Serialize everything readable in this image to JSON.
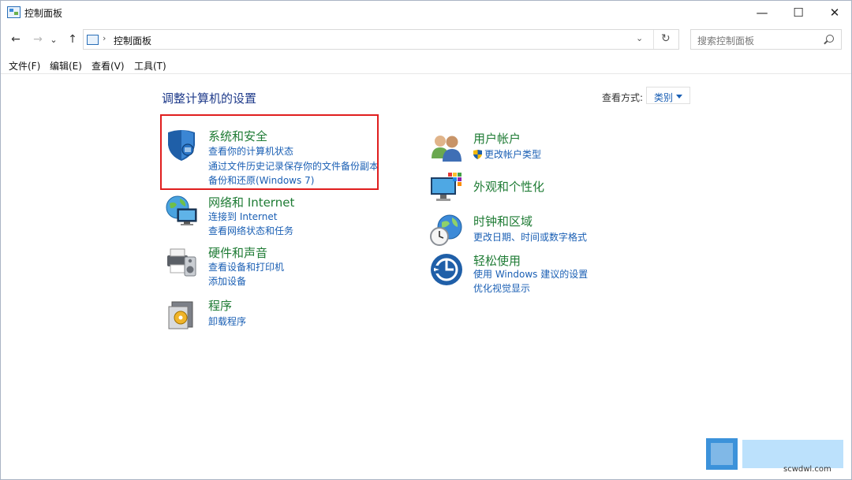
{
  "window": {
    "title": "控制面板",
    "minimize": "—",
    "maximize": "☐",
    "close": "✕"
  },
  "nav": {
    "back": "←",
    "forward": "→",
    "recent": "⌄",
    "up": "↑",
    "address_separator": "›",
    "address": "控制面板",
    "address_dropdown": "⌄",
    "refresh": "↻",
    "search_placeholder": "搜索控制面板"
  },
  "menu": [
    "文件(F)",
    "编辑(E)",
    "查看(V)",
    "工具(T)"
  ],
  "main": {
    "heading": "调整计算机的设置",
    "view_by_label": "查看方式:",
    "view_by_value": "类别"
  },
  "categories_left": [
    {
      "title": "系统和安全",
      "icon": "shield-icon",
      "links": [
        "查看你的计算机状态",
        "通过文件历史记录保存你的文件备份副本",
        "备份和还原(Windows 7)"
      ]
    },
    {
      "title": "网络和 Internet",
      "icon": "network-globe-icon",
      "links": [
        "连接到 Internet",
        "查看网络状态和任务"
      ]
    },
    {
      "title": "硬件和声音",
      "icon": "printer-speaker-icon",
      "links": [
        "查看设备和打印机",
        "添加设备"
      ]
    },
    {
      "title": "程序",
      "icon": "programs-icon",
      "links": [
        "卸载程序"
      ]
    }
  ],
  "categories_right": [
    {
      "title": "用户帐户",
      "icon": "users-icon",
      "links": [
        "更改帐户类型"
      ]
    },
    {
      "title": "外观和个性化",
      "icon": "monitor-palette-icon",
      "links": []
    },
    {
      "title": "时钟和区域",
      "icon": "clock-globe-icon",
      "links": [
        "更改日期、时间或数字格式"
      ]
    },
    {
      "title": "轻松使用",
      "icon": "ease-of-access-icon",
      "links": [
        "使用 Windows 建议的设置",
        "优化视觉显示"
      ]
    }
  ],
  "watermark": {
    "url": "scwdwl.com"
  },
  "colors": {
    "category_title": "#1e7b34",
    "link": "#1a5fb4",
    "heading": "#1e3a8a",
    "highlight_box": "#e01e1e"
  }
}
